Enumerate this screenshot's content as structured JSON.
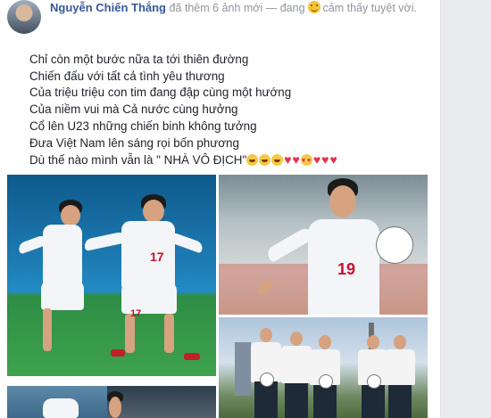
{
  "post": {
    "author": "Nguyễn Chiến Thắng",
    "action": "đã thêm 6 ảnh mới",
    "separator": "—",
    "feeling_prefix": "đang",
    "feeling_text": "cảm thấy tuyệt vời.",
    "lines": [
      "Chỉ còn một bước nữa ta tới thiên đường",
      "Chiến đấu với tất cả tình yêu thương",
      "Của triệu triệu con tim đang đập cùng một hướng",
      "Của niềm vui mà Cả nước cùng hưởng",
      "Cổ lên U23 những chiến binh không tưởng",
      "Đưa Việt Nam lên sáng rọi bốn phương",
      "Dù thế nào mình vẫn là \" NHÀ VÔ ĐỊCH\""
    ],
    "emoji_tail": [
      "laughing-emoji",
      "laughing-emoji",
      "laughing-emoji",
      "heart",
      "heart",
      "heart-eyes-emoji",
      "heart",
      "heart",
      "heart"
    ]
  },
  "photos": {
    "p1_numbers": [
      "17",
      "17"
    ],
    "p2_number": "19"
  },
  "colors": {
    "author": "#365899",
    "meta": "#90949c",
    "text": "#1d2129",
    "heart": "#e8304f"
  }
}
